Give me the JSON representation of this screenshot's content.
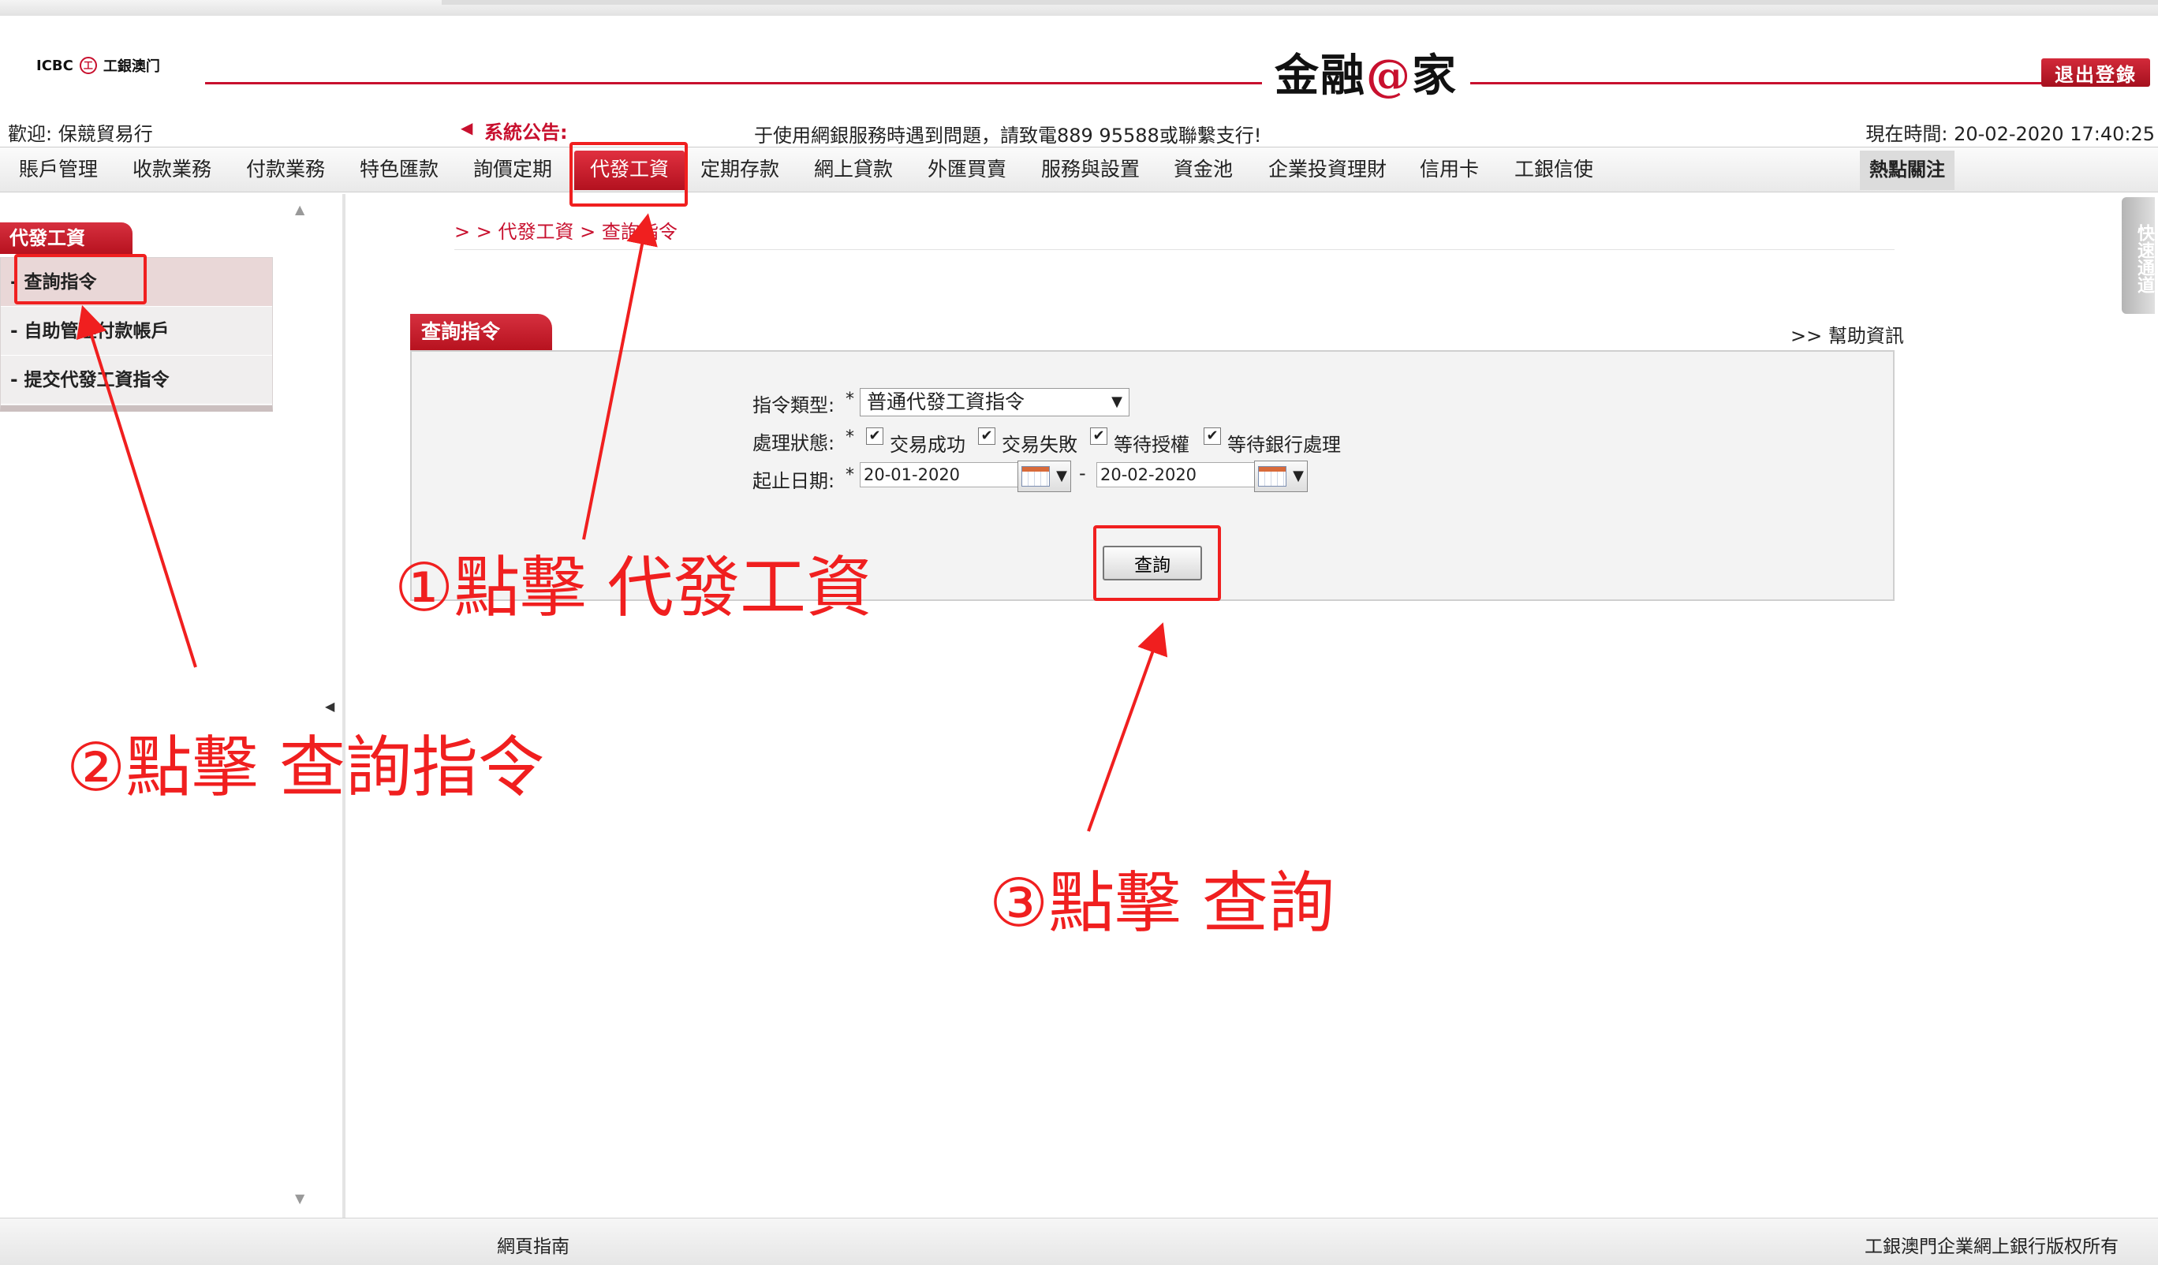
{
  "header": {
    "logo_text": "ICBC",
    "logo_mark": "工",
    "logo_sub": "工銀澳门",
    "brand_left": "金融",
    "brand_at": "@",
    "brand_right": "家",
    "logout_label": "退出登錄"
  },
  "info": {
    "welcome": "歡迎:  保競貿易行",
    "notice_label": "系統公告:",
    "notice_text": "于使用網銀服務時遇到問題，請致電889 95588或聯繫支行!",
    "clock": "現在時間:  20-02-2020 17:40:25"
  },
  "nav": {
    "items": [
      "賬戶管理",
      "收款業務",
      "付款業務",
      "特色匯款",
      "詢價定期",
      "代發工資",
      "定期存款",
      "網上貸款",
      "外匯買賣",
      "服務與設置",
      "資金池",
      "企業投資理財",
      "信用卡",
      "工銀信使"
    ],
    "hot": "熱點關注"
  },
  "sidebar": {
    "title": "代發工資",
    "items": [
      "- 查詢指令",
      "- 自助管理付款帳戶",
      "- 提交代發工資指令"
    ]
  },
  "main": {
    "breadcrumb": "> > 代發工資 > 查詢指令",
    "panel_title": "查詢指令",
    "help_link": ">> 幫助資訊",
    "form": {
      "type_label": "指令類型:",
      "type_value": "普通代發工資指令",
      "status_label": "處理狀態:",
      "statuses": [
        "交易成功",
        "交易失敗",
        "等待授權",
        "等待銀行處理"
      ],
      "date_label": "起止日期:",
      "date_from": "20-01-2020",
      "date_to": "20-02-2020",
      "required_mark": "*",
      "query_button": "查詢"
    },
    "quick_channel": "快速通道"
  },
  "footer": {
    "left": "網頁指南",
    "right": "工銀澳門企業網上銀行版权所有"
  },
  "annotations": {
    "step1": "①點擊 代發工資",
    "step2": "②點擊 查詢指令",
    "step3": "③點擊 查詢"
  },
  "colors": {
    "accent_red": "#c8102e",
    "annotation_red": "#f01f1f"
  }
}
